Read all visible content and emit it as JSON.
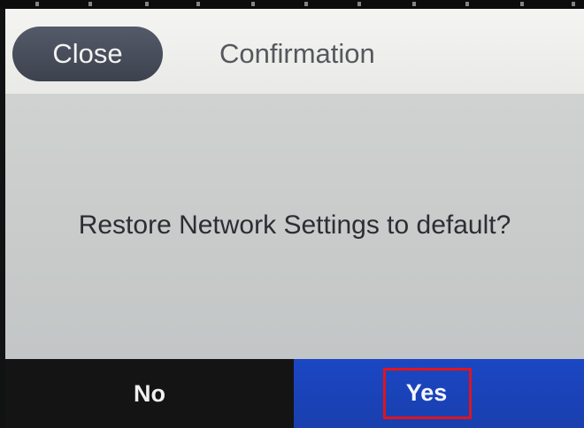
{
  "header": {
    "close_label": "Close",
    "title": "Confirmation"
  },
  "dialog": {
    "message": "Restore Network Settings to default?"
  },
  "footer": {
    "no_label": "No",
    "yes_label": "Yes"
  },
  "colors": {
    "close_button_bg": "#4a4f5c",
    "header_bg": "#efefed",
    "message_bg": "#cacdcc",
    "no_button_bg": "#141414",
    "yes_button_bg": "#1a44bb",
    "highlight_border": "#e0141c"
  }
}
